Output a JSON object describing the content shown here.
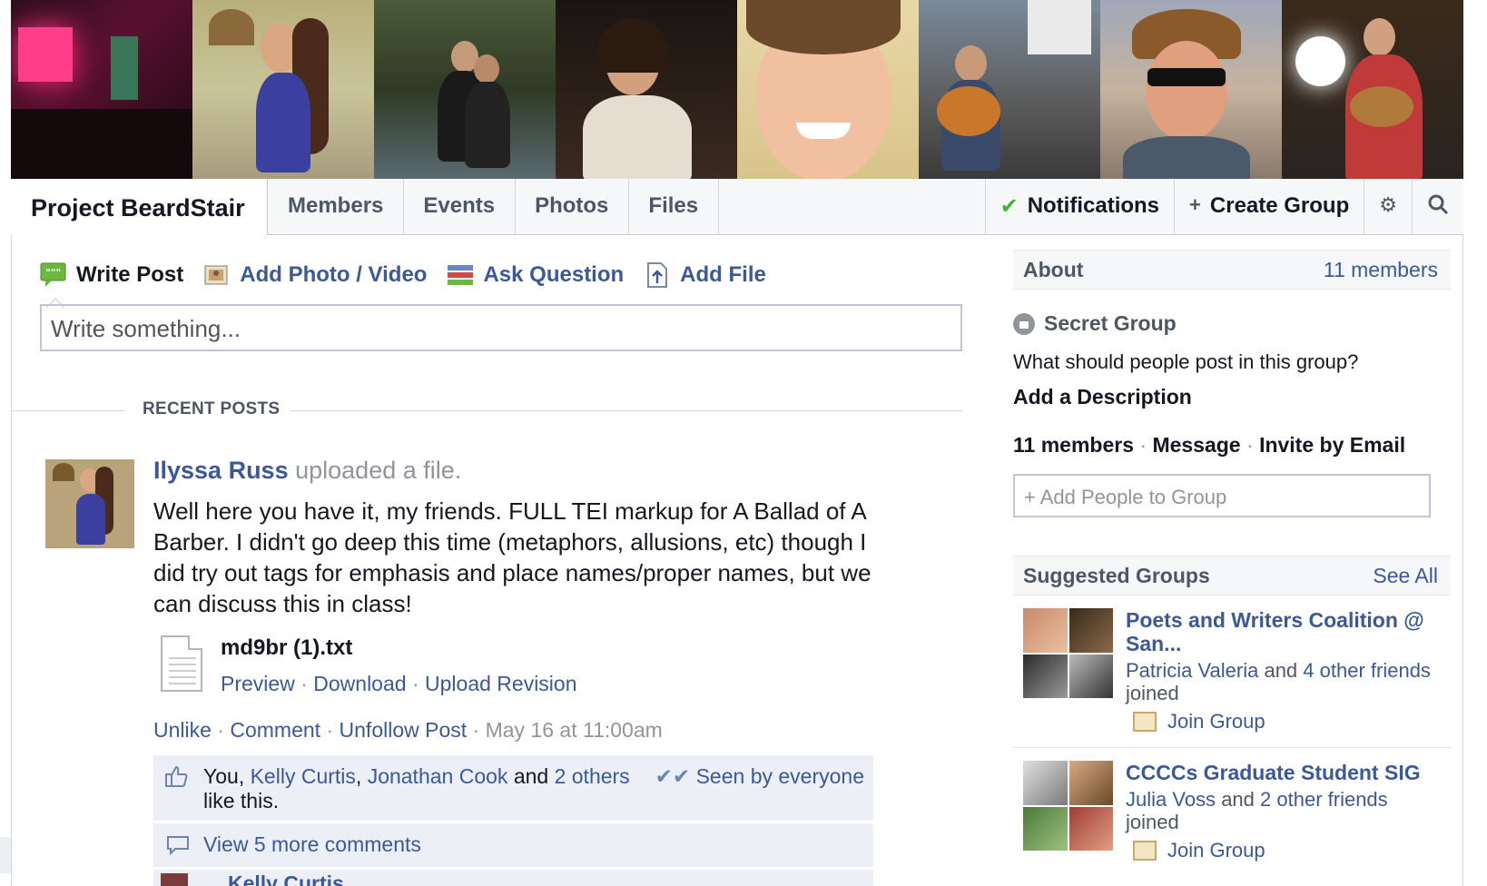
{
  "nav": {
    "group_name": "Project BeardStair",
    "tabs": [
      "Members",
      "Events",
      "Photos",
      "Files"
    ],
    "notifications": "Notifications",
    "create_group": "Create Group"
  },
  "composer": {
    "tabs": [
      {
        "label": "Write Post",
        "icon": "speech-bubble-icon"
      },
      {
        "label": "Add Photo / Video",
        "icon": "photo-icon"
      },
      {
        "label": "Ask Question",
        "icon": "question-list-icon"
      },
      {
        "label": "Add File",
        "icon": "file-upload-icon"
      }
    ],
    "placeholder": "Write something..."
  },
  "recent_label": "RECENT POSTS",
  "post": {
    "author": "Ilyssa Russ",
    "action": "uploaded a file.",
    "body": "Well here you have it, my friends. FULL TEI markup for A Ballad of A Barber. I didn't go deep this time (metaphors, allusions, etc) though I did try out tags for emphasis and place names/proper names, but we can discuss this in class!",
    "file_name": "md9br (1).txt",
    "file_actions": [
      "Preview",
      "Download",
      "Upload Revision"
    ],
    "actions": [
      "Unlike",
      "Comment",
      "Unfollow Post"
    ],
    "timestamp": "May 16 at 11:00am",
    "likes": {
      "you": "You,",
      "names": [
        "Kelly Curtis",
        "Jonathan Cook"
      ],
      "and": "and",
      "others": "2 others",
      "suffix": "like this.",
      "seen": "Seen by everyone"
    },
    "more_comments": "View 5 more comments",
    "comment_peek": "Kelly Curtis"
  },
  "sidebar": {
    "about_title": "About",
    "members_count": "11 members",
    "privacy": "Secret Group",
    "question": "What should people post in this group?",
    "add_description": "Add a Description",
    "links": [
      "11 members",
      "Message",
      "Invite by Email"
    ],
    "add_people_placeholder": "+ Add People to Group",
    "suggested_title": "Suggested Groups",
    "see_all": "See All",
    "groups": [
      {
        "name": "Poets and Writers Coalition @ San...",
        "friend": "Patricia Valeria",
        "and": "and",
        "others": "4 other friends",
        "joined": "joined",
        "join": "Join Group"
      },
      {
        "name": "CCCCs Graduate Student SIG",
        "friend": "Julia Voss",
        "and": "and",
        "others": "2 other friends",
        "joined": "joined",
        "join": "Join Group"
      }
    ]
  },
  "colors": {
    "link": "#3b5998",
    "nav_bg": "#f6f7f9",
    "like_bg": "#eceff5",
    "check": "#42b72a"
  }
}
